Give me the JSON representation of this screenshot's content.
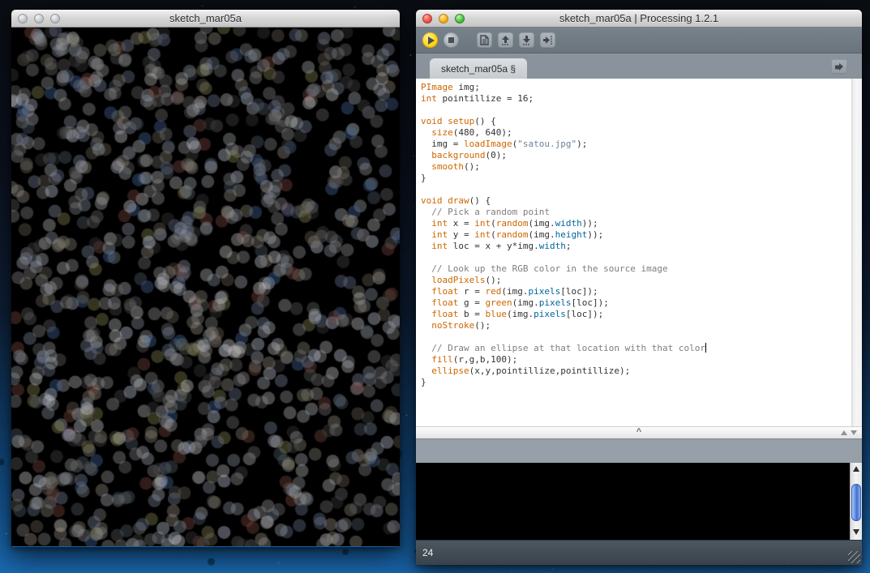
{
  "desktop": {
    "gradient": [
      [
        "#0a0d13",
        0
      ],
      [
        "#0c1220",
        0.3
      ],
      [
        "#0e2038",
        0.55
      ],
      [
        "#124a80",
        0.82
      ],
      [
        "#1a6ab2",
        1
      ]
    ],
    "star_color": "#ffffff",
    "star_count": 120,
    "dark_dot_count": 14,
    "seed": 77
  },
  "sketch_window": {
    "title": "sketch_mar05a",
    "render": {
      "bg": "#000000",
      "dot_diameter": 16,
      "dot_alpha": 0.38,
      "dot_count": 1150,
      "seed": 1337,
      "palette": [
        "#9c9c9c",
        "#8a8a8a",
        "#777777",
        "#bdbdbd",
        "#5f5f5f",
        "#4a4a4a",
        "#a6aab0",
        "#8e96a4",
        "#6d7892",
        "#53606f",
        "#d2d2d6",
        "#8c8575",
        "#6e675a",
        "#3c3c3c",
        "#9a9186",
        "#7e8aa0",
        "#8a8a8a",
        "#9c9c9c",
        "#6b6b6b",
        "#b0b4bc",
        "#7d4a43",
        "#8a8a55",
        "#4a6a9a",
        "#c8d0e0"
      ]
    }
  },
  "ide_window": {
    "title": "sketch_mar05a | Processing 1.2.1",
    "toolbar": {
      "buttons": [
        "run",
        "stop",
        "new-sketch",
        "open",
        "save",
        "export"
      ]
    },
    "tab": {
      "label": "sketch_mar05a §"
    },
    "editor": {
      "token_colors": {
        "plain": "#333333",
        "keyword": "#cc6600",
        "function": "#cc6600",
        "literal": "#006699",
        "string": "#6e8295",
        "comment": "#7e7e7e"
      },
      "caret_line": 23,
      "lines": [
        [
          {
            "t": "PImage",
            "c": "keyword"
          },
          {
            "t": " img;",
            "c": "plain"
          }
        ],
        [
          {
            "t": "int",
            "c": "keyword"
          },
          {
            "t": " pointillize = 16;",
            "c": "plain"
          }
        ],
        [],
        [
          {
            "t": "void",
            "c": "keyword"
          },
          {
            "t": " ",
            "c": "plain"
          },
          {
            "t": "setup",
            "c": "function"
          },
          {
            "t": "() {",
            "c": "plain"
          }
        ],
        [
          {
            "t": "  ",
            "c": "plain"
          },
          {
            "t": "size",
            "c": "function"
          },
          {
            "t": "(480, 640);",
            "c": "plain"
          }
        ],
        [
          {
            "t": "  img = ",
            "c": "plain"
          },
          {
            "t": "loadImage",
            "c": "function"
          },
          {
            "t": "(",
            "c": "plain"
          },
          {
            "t": "\"satou.jpg\"",
            "c": "string"
          },
          {
            "t": ");",
            "c": "plain"
          }
        ],
        [
          {
            "t": "  ",
            "c": "plain"
          },
          {
            "t": "background",
            "c": "function"
          },
          {
            "t": "(0);",
            "c": "plain"
          }
        ],
        [
          {
            "t": "  ",
            "c": "plain"
          },
          {
            "t": "smooth",
            "c": "function"
          },
          {
            "t": "();",
            "c": "plain"
          }
        ],
        [
          {
            "t": "}",
            "c": "plain"
          }
        ],
        [],
        [
          {
            "t": "void",
            "c": "keyword"
          },
          {
            "t": " ",
            "c": "plain"
          },
          {
            "t": "draw",
            "c": "function"
          },
          {
            "t": "() {",
            "c": "plain"
          }
        ],
        [
          {
            "t": "  ",
            "c": "plain"
          },
          {
            "t": "// Pick a random point",
            "c": "comment"
          }
        ],
        [
          {
            "t": "  ",
            "c": "plain"
          },
          {
            "t": "int",
            "c": "keyword"
          },
          {
            "t": " x = ",
            "c": "plain"
          },
          {
            "t": "int",
            "c": "function"
          },
          {
            "t": "(",
            "c": "plain"
          },
          {
            "t": "random",
            "c": "function"
          },
          {
            "t": "(img.",
            "c": "plain"
          },
          {
            "t": "width",
            "c": "literal"
          },
          {
            "t": "));",
            "c": "plain"
          }
        ],
        [
          {
            "t": "  ",
            "c": "plain"
          },
          {
            "t": "int",
            "c": "keyword"
          },
          {
            "t": " y = ",
            "c": "plain"
          },
          {
            "t": "int",
            "c": "function"
          },
          {
            "t": "(",
            "c": "plain"
          },
          {
            "t": "random",
            "c": "function"
          },
          {
            "t": "(img.",
            "c": "plain"
          },
          {
            "t": "height",
            "c": "literal"
          },
          {
            "t": "));",
            "c": "plain"
          }
        ],
        [
          {
            "t": "  ",
            "c": "plain"
          },
          {
            "t": "int",
            "c": "keyword"
          },
          {
            "t": " loc = x + y*img.",
            "c": "plain"
          },
          {
            "t": "width",
            "c": "literal"
          },
          {
            "t": ";",
            "c": "plain"
          }
        ],
        [],
        [
          {
            "t": "  ",
            "c": "plain"
          },
          {
            "t": "// Look up the RGB color in the source image",
            "c": "comment"
          }
        ],
        [
          {
            "t": "  ",
            "c": "plain"
          },
          {
            "t": "loadPixels",
            "c": "function"
          },
          {
            "t": "();",
            "c": "plain"
          }
        ],
        [
          {
            "t": "  ",
            "c": "plain"
          },
          {
            "t": "float",
            "c": "keyword"
          },
          {
            "t": " r = ",
            "c": "plain"
          },
          {
            "t": "red",
            "c": "function"
          },
          {
            "t": "(img.",
            "c": "plain"
          },
          {
            "t": "pixels",
            "c": "literal"
          },
          {
            "t": "[loc]);",
            "c": "plain"
          }
        ],
        [
          {
            "t": "  ",
            "c": "plain"
          },
          {
            "t": "float",
            "c": "keyword"
          },
          {
            "t": " g = ",
            "c": "plain"
          },
          {
            "t": "green",
            "c": "function"
          },
          {
            "t": "(img.",
            "c": "plain"
          },
          {
            "t": "pixels",
            "c": "literal"
          },
          {
            "t": "[loc]);",
            "c": "plain"
          }
        ],
        [
          {
            "t": "  ",
            "c": "plain"
          },
          {
            "t": "float",
            "c": "keyword"
          },
          {
            "t": " b = ",
            "c": "plain"
          },
          {
            "t": "blue",
            "c": "function"
          },
          {
            "t": "(img.",
            "c": "plain"
          },
          {
            "t": "pixels",
            "c": "literal"
          },
          {
            "t": "[loc]);",
            "c": "plain"
          }
        ],
        [
          {
            "t": "  ",
            "c": "plain"
          },
          {
            "t": "noStroke",
            "c": "function"
          },
          {
            "t": "();",
            "c": "plain"
          }
        ],
        [],
        [
          {
            "t": "  ",
            "c": "plain"
          },
          {
            "t": "// Draw an ellipse at that location with that color",
            "c": "comment"
          }
        ],
        [
          {
            "t": "  ",
            "c": "plain"
          },
          {
            "t": "fill",
            "c": "function"
          },
          {
            "t": "(r,g,b,100);",
            "c": "plain"
          }
        ],
        [
          {
            "t": "  ",
            "c": "plain"
          },
          {
            "t": "ellipse",
            "c": "function"
          },
          {
            "t": "(x,y,pointillize,pointillize);",
            "c": "plain"
          }
        ],
        [
          {
            "t": "}",
            "c": "plain"
          }
        ]
      ]
    },
    "message_area": {
      "text": ""
    },
    "console": {
      "text": ""
    },
    "status_bar": {
      "line_number": "24"
    },
    "dimple_glyph": "^"
  }
}
